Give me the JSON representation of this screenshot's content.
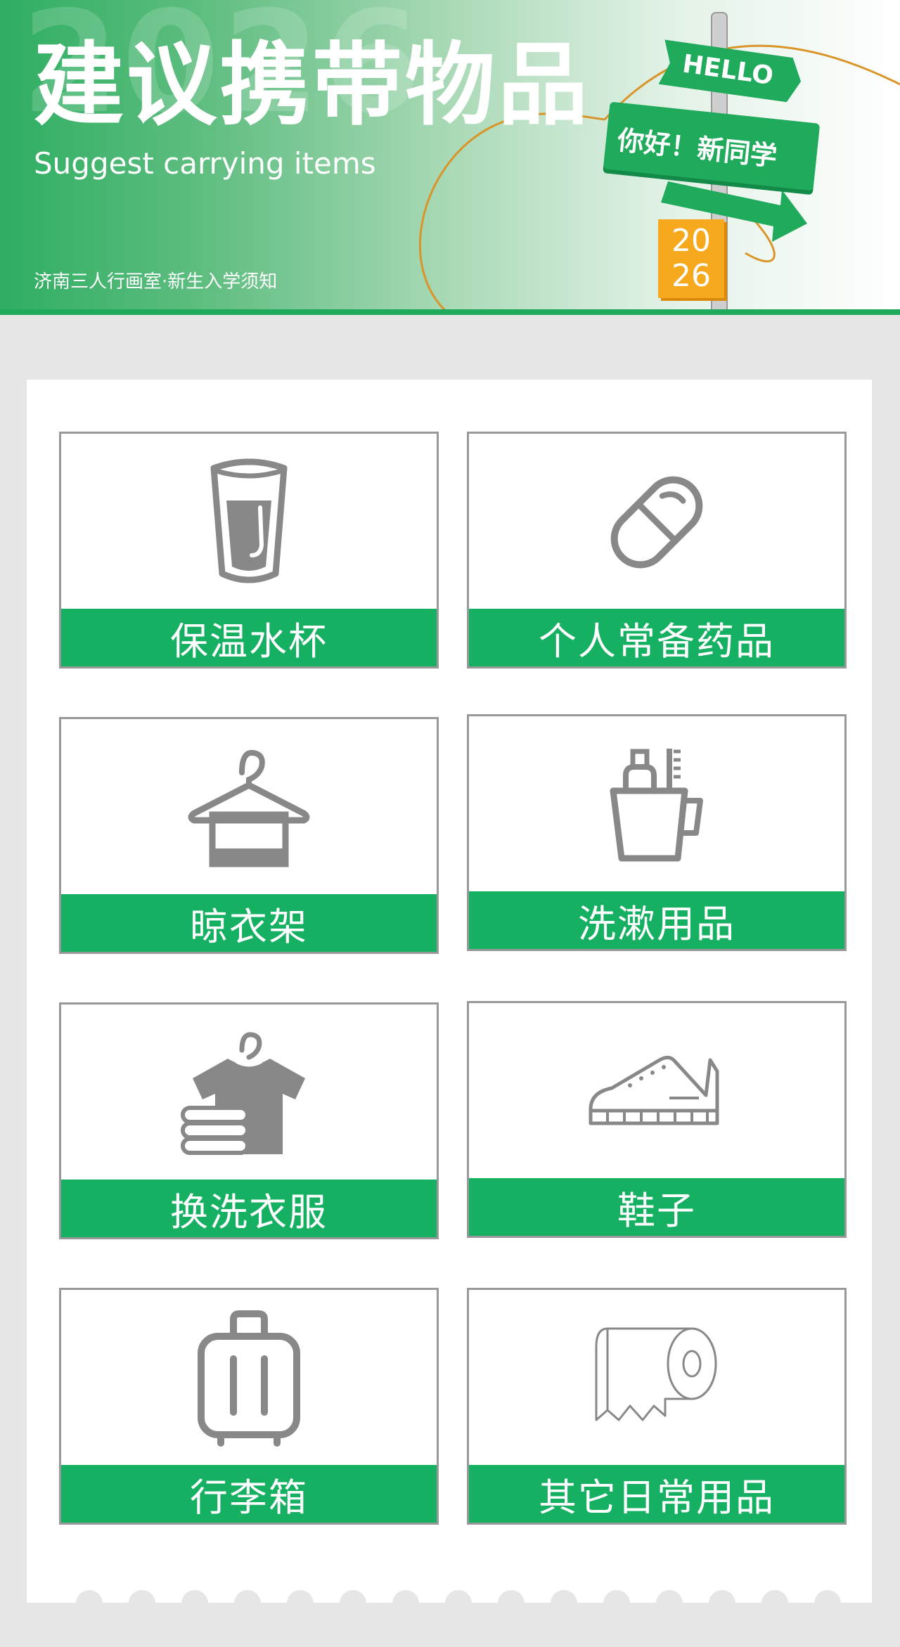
{
  "header": {
    "watermark_year": "2026",
    "title_cn": "建议携带物品",
    "title_en": "Suggest carrying items",
    "subtitle": "济南三人行画室·新生入学须知",
    "sign_hello": "HELLO",
    "sign_greeting": "你好！新同学",
    "sign_year_top": "20",
    "sign_year_bottom": "26"
  },
  "items": [
    {
      "label": "保温水杯",
      "icon": "cup-icon"
    },
    {
      "label": "个人常备药品",
      "icon": "pill-icon"
    },
    {
      "label": "晾衣架",
      "icon": "hanger-icon"
    },
    {
      "label": "洗漱用品",
      "icon": "toiletries-icon"
    },
    {
      "label": "换洗衣服",
      "icon": "clothes-icon"
    },
    {
      "label": "鞋子",
      "icon": "shoe-icon"
    },
    {
      "label": "行李箱",
      "icon": "suitcase-icon"
    },
    {
      "label": "其它日常用品",
      "icon": "toilet-paper-icon"
    }
  ],
  "colors": {
    "brand_green": "#15b062",
    "icon_gray": "#888888",
    "accent_orange": "#f6a91c",
    "background": "#e6e6e6"
  }
}
